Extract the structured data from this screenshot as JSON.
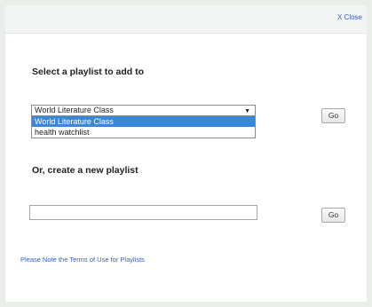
{
  "header": {
    "close_label": "X Close"
  },
  "select_section": {
    "heading": "Select a playlist to add to",
    "selected_value": "World Literature Class",
    "arrow_glyph": "▼",
    "options": [
      {
        "label": "World Literature Class",
        "selected": true
      },
      {
        "label": "health watchlist",
        "selected": false
      }
    ],
    "go_label": "Go"
  },
  "create_section": {
    "heading": "Or, create a new playlist",
    "input_value": "",
    "go_label": "Go"
  },
  "footer": {
    "terms_link": "Please Note the Terms of Use for Playlists"
  },
  "colors": {
    "background": "#e9eee9",
    "panel": "#ffffff",
    "link": "#3b5fb8",
    "selection": "#3a86d8"
  }
}
